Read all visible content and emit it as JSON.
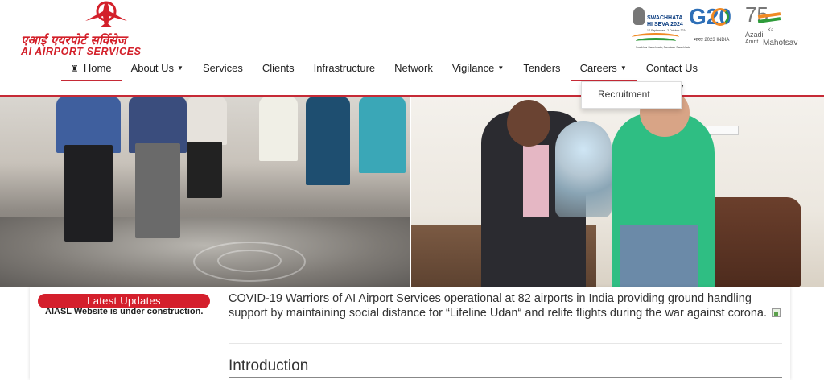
{
  "brand": {
    "hindi_name": "एआई एयरपोर्ट सर्विसेज",
    "english_name": "AI AIRPORT SERVICES",
    "brand_color": "#d3202a"
  },
  "badges": {
    "swachhata": {
      "line1": "SWACHHATA",
      "line2": "HI SEVA 2024",
      "line3": "17 September - 2 October 2024",
      "line4": "Swabhav Swachhata, Sanskaar Swachhata"
    },
    "g20": {
      "title": "G20",
      "subtitle": "भारत 2023 INDIA"
    },
    "azadi": {
      "number": "75",
      "line1": "Azadi",
      "ka": "Ka",
      "line2": "Amrit",
      "line3": "Mahotsav"
    }
  },
  "nav": {
    "home": "Home",
    "about": "About Us",
    "services": "Services",
    "clients": "Clients",
    "infrastructure": "Infrastructure",
    "network": "Network",
    "vigilance": "Vigilance",
    "tenders": "Tenders",
    "careers": "Careers",
    "contact": "Contact Us",
    "hidden_fragment": "y",
    "accent_color": "#c62a36"
  },
  "careers_dropdown": {
    "items": [
      "Recruitment"
    ]
  },
  "latest_updates": {
    "title": "Latest   Updates",
    "text": "AIASL Website is under construction."
  },
  "main": {
    "covid_text": "COVID-19 Warriors of AI Airport Services operational at 82 airports in India providing ground handling support by maintaining social distance for “Lifeline Udan“ and relife flights during the war against corona.",
    "intro_heading": "Introduction"
  }
}
